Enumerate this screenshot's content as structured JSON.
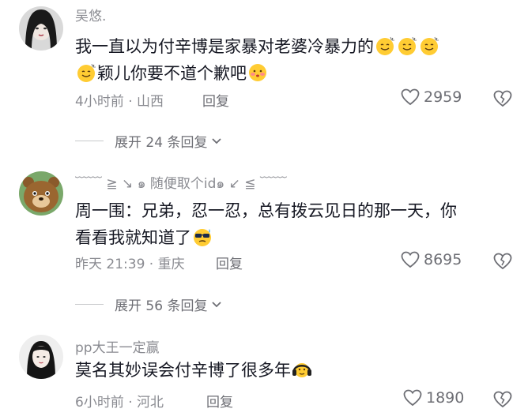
{
  "comments": [
    {
      "username": "吴悠.",
      "line1": "我一直以为付辛博是家暴对老婆冷暴力的",
      "line2": "颖儿你要不道个歉吧",
      "time_location": "4小时前 · 山西",
      "reply_label": "回复",
      "likes": "2959",
      "expand": "展开 24 条回复",
      "emoji_line1": [
        "smile-sweat-emoji",
        "smile-sweat-emoji",
        "smile-sweat-emoji"
      ],
      "emoji_line2_start": "smile-sweat-emoji",
      "emoji_line2_end": "shy-emoji"
    },
    {
      "username": "﹋﹋ ≧ ↘ ๑ 随便取个id๑ ↙ ≦ ﹋﹋",
      "line1": "周一围：兄弟，忍一忍，总有拨云见日的那一天，你",
      "line2": "看看我就知道了",
      "time_location": "昨天 21:39 · 重庆",
      "reply_label": "回复",
      "likes": "8695",
      "expand": "展开 56 条回复",
      "emoji_line2_end": "cool-sweat-emoji"
    },
    {
      "username": "pp大王一定赢",
      "line1": "莫名其妙误会付辛博了很多年",
      "time_location": "6小时前 · 河北",
      "reply_label": "回复",
      "likes": "1890",
      "emoji_line1_end": "headphone-emoji"
    }
  ],
  "colors": {
    "text": "#161823",
    "muted": "#8a8b91",
    "emoji_yellow": "#ffcc33"
  }
}
